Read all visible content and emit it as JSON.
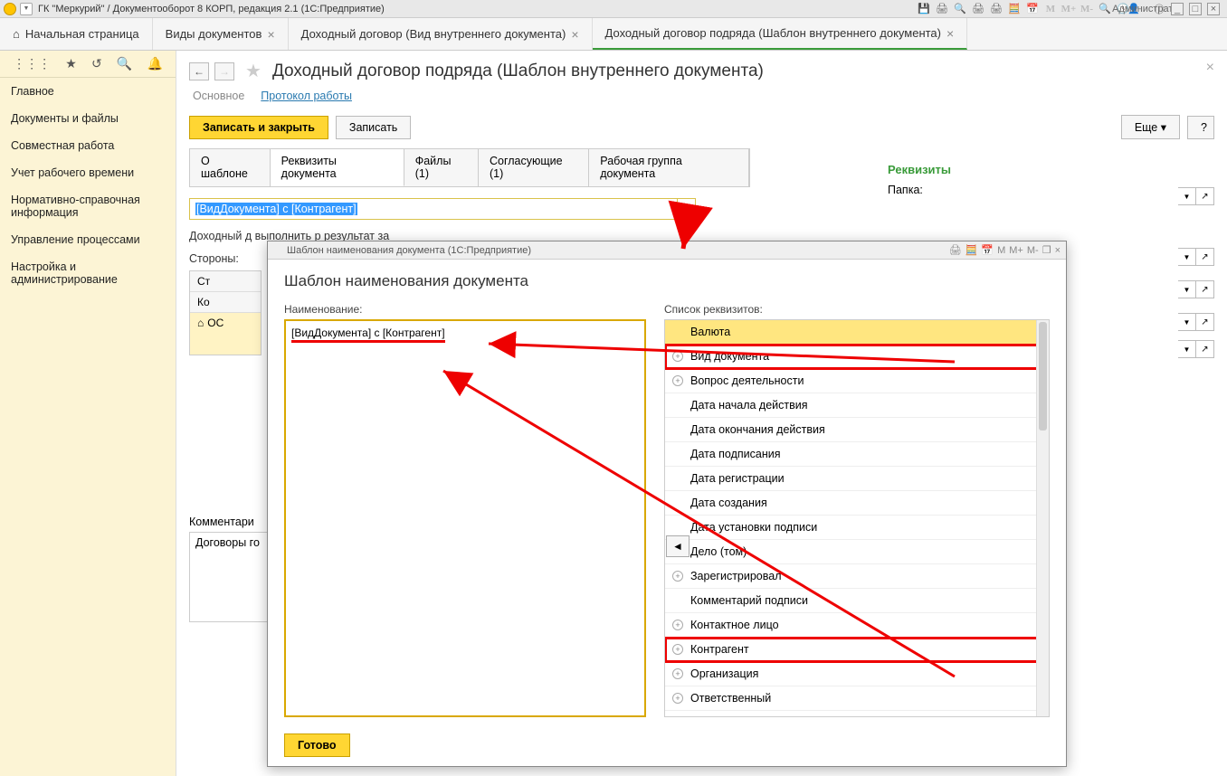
{
  "titlebar": {
    "text": "ГК \"Меркурий\" / Документооборот 8 КОРП, редакция 2.1  (1С:Предприятие)",
    "user": "Администратор",
    "m1": "M",
    "m2": "M+",
    "m3": "M-"
  },
  "tabs": {
    "home": "Начальная страница",
    "t1": "Виды документов",
    "t2": "Доходный договор (Вид внутреннего документа)",
    "t3": "Доходный договор подряда (Шаблон внутреннего документа)"
  },
  "sidebar": {
    "items": [
      "Главное",
      "Документы и файлы",
      "Совместная работа",
      "Учет рабочего времени",
      "Нормативно-справочная информация",
      "Управление процессами",
      "Настройка и администрирование"
    ]
  },
  "page": {
    "title": "Доходный договор подряда (Шаблон внутреннего документа)",
    "subtabs": {
      "main": "Основное",
      "log": "Протокол работы"
    },
    "actions": {
      "save_close": "Записать и закрыть",
      "save": "Записать",
      "more": "Еще",
      "help": "?"
    },
    "doc_tabs": {
      "about": "О шаблоне",
      "req": "Реквизиты документа",
      "files": "Файлы (1)",
      "appr": "Согласующие (1)",
      "wg": "Рабочая группа документа"
    },
    "name_value": "[ВидДокумента] с [Контрагент]",
    "desc": "Доходный д\nвыполнить р\nрезультат за",
    "sides_label": "Стороны:",
    "table_headers": {
      "side": "Ст",
      "contr": "Ко",
      "main": "ОС"
    },
    "right_title": "Реквизиты",
    "right_first_label": "Папка:",
    "comment_label": "Комментари",
    "comment_value": "Договоры го"
  },
  "modal": {
    "win_title": "Шаблон наименования документа  (1С:Предприятие)",
    "title": "Шаблон наименования документа",
    "left_label": "Наименование:",
    "left_value": "[ВидДокумента] с [Контрагент]",
    "right_label": "Список реквизитов:",
    "items": [
      {
        "label": "Валюта",
        "exp": false,
        "hl": true
      },
      {
        "label": "Вид документа",
        "exp": true,
        "boxed": true
      },
      {
        "label": "Вопрос деятельности",
        "exp": true
      },
      {
        "label": "Дата начала действия",
        "exp": false
      },
      {
        "label": "Дата окончания действия",
        "exp": false
      },
      {
        "label": "Дата подписания",
        "exp": false
      },
      {
        "label": "Дата регистрации",
        "exp": false
      },
      {
        "label": "Дата создания",
        "exp": false
      },
      {
        "label": "Дата установки подписи",
        "exp": false
      },
      {
        "label": "Дело (том)",
        "exp": true
      },
      {
        "label": "Зарегистрировал",
        "exp": true
      },
      {
        "label": "Комментарий подписи",
        "exp": false
      },
      {
        "label": "Контактное лицо",
        "exp": true
      },
      {
        "label": "Контрагент",
        "exp": true,
        "boxed": true
      },
      {
        "label": "Организация",
        "exp": true
      },
      {
        "label": "Ответственный",
        "exp": true
      }
    ],
    "done": "Готово"
  }
}
